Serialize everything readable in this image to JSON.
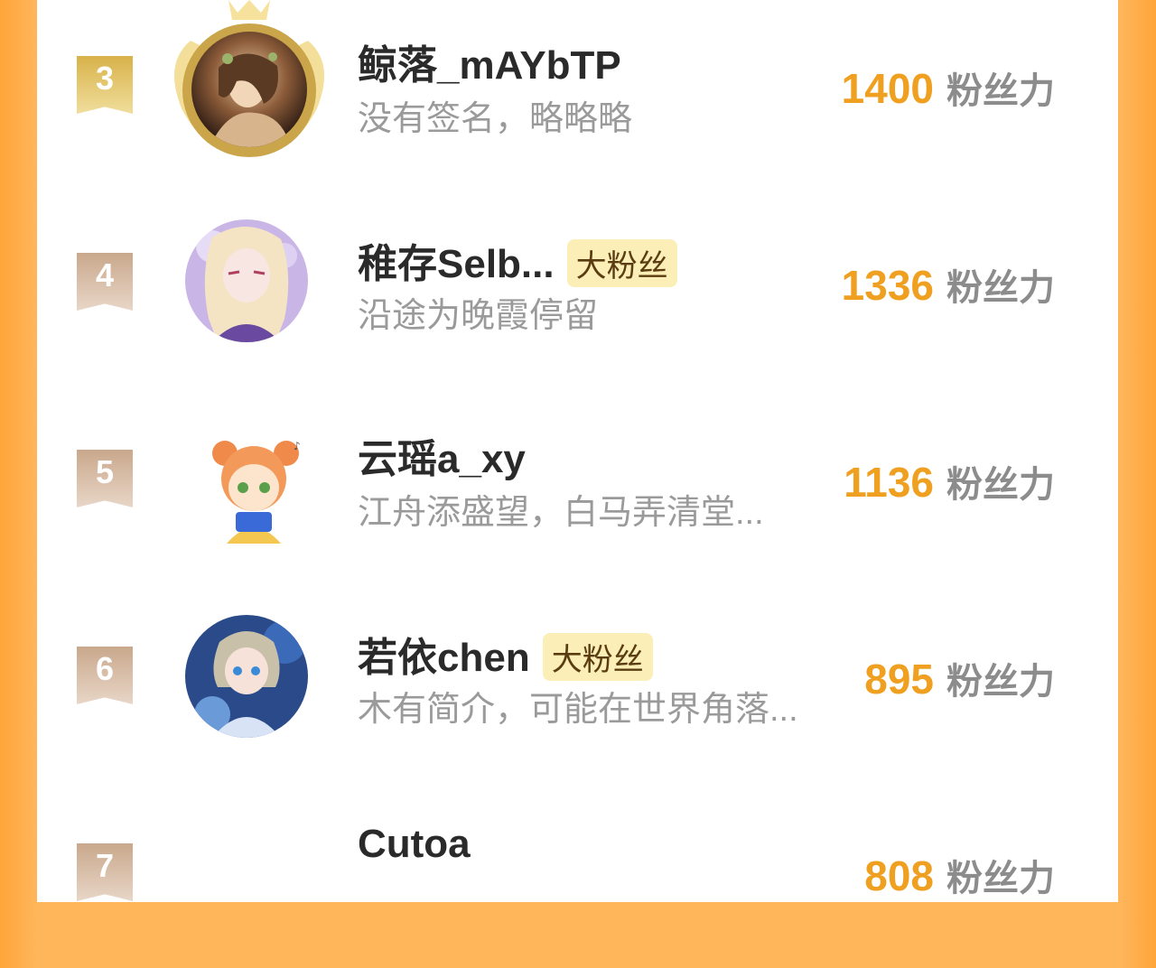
{
  "unit_label": "粉丝力",
  "colors": {
    "accent": "#f0a020",
    "background": "#ffb55a",
    "badge_bg": "#fbeeb7"
  },
  "rows": [
    {
      "rank": "3",
      "name": "鲸落_mAYbTP",
      "badge": "",
      "signature": "没有签名，略略略",
      "score": "1400",
      "avatar": "crowned-avatar"
    },
    {
      "rank": "4",
      "name": "稚存Selb...",
      "badge": "大粉丝",
      "signature": "沿途为晚霞停留",
      "score": "1336",
      "avatar": "anime-girl-avatar"
    },
    {
      "rank": "5",
      "name": "云瑶a_xy",
      "badge": "",
      "signature": "江舟添盛望，白马弄清堂...",
      "score": "1136",
      "avatar": "chibi-girl-avatar"
    },
    {
      "rank": "6",
      "name": "若依chen",
      "badge": "大粉丝",
      "signature": "木有简介，可能在世界角落...",
      "score": "895",
      "avatar": "blue-anime-avatar"
    },
    {
      "rank": "7",
      "name": "Cutoa",
      "badge": "",
      "signature": "",
      "score": "808",
      "avatar": ""
    }
  ]
}
